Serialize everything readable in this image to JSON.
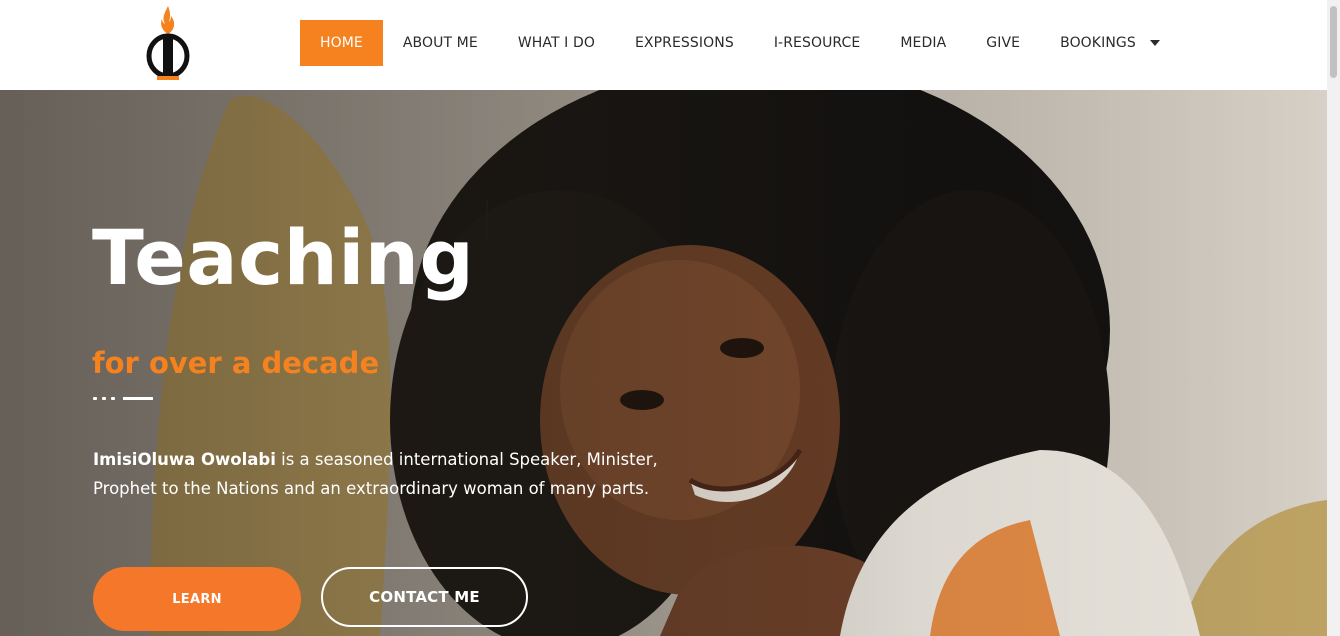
{
  "header": {
    "logo_icon": "flame-logo-icon",
    "nav": [
      {
        "label": "HOME",
        "active": true
      },
      {
        "label": "ABOUT ME",
        "active": false
      },
      {
        "label": "WHAT I DO",
        "active": false
      },
      {
        "label": "EXPRESSIONS",
        "active": false
      },
      {
        "label": "I-RESOURCE",
        "active": false
      },
      {
        "label": "MEDIA",
        "active": false
      },
      {
        "label": "GIVE",
        "active": false
      },
      {
        "label": "BOOKINGS",
        "active": false,
        "has_dropdown": true
      }
    ]
  },
  "hero": {
    "title": "Teaching",
    "subtitle": "for over a decade",
    "description_name": "ImisiOluwa Owolabi",
    "description_rest": " is a seasoned international Speaker, Minister, Prophet to the Nations and an extraordinary woman of many parts.",
    "primary_button": "LEARN",
    "secondary_button": "CONTACT ME"
  },
  "colors": {
    "accent": "#f5821f",
    "button": "#f5782a",
    "text_dark": "#2b2b2b",
    "white": "#ffffff"
  }
}
